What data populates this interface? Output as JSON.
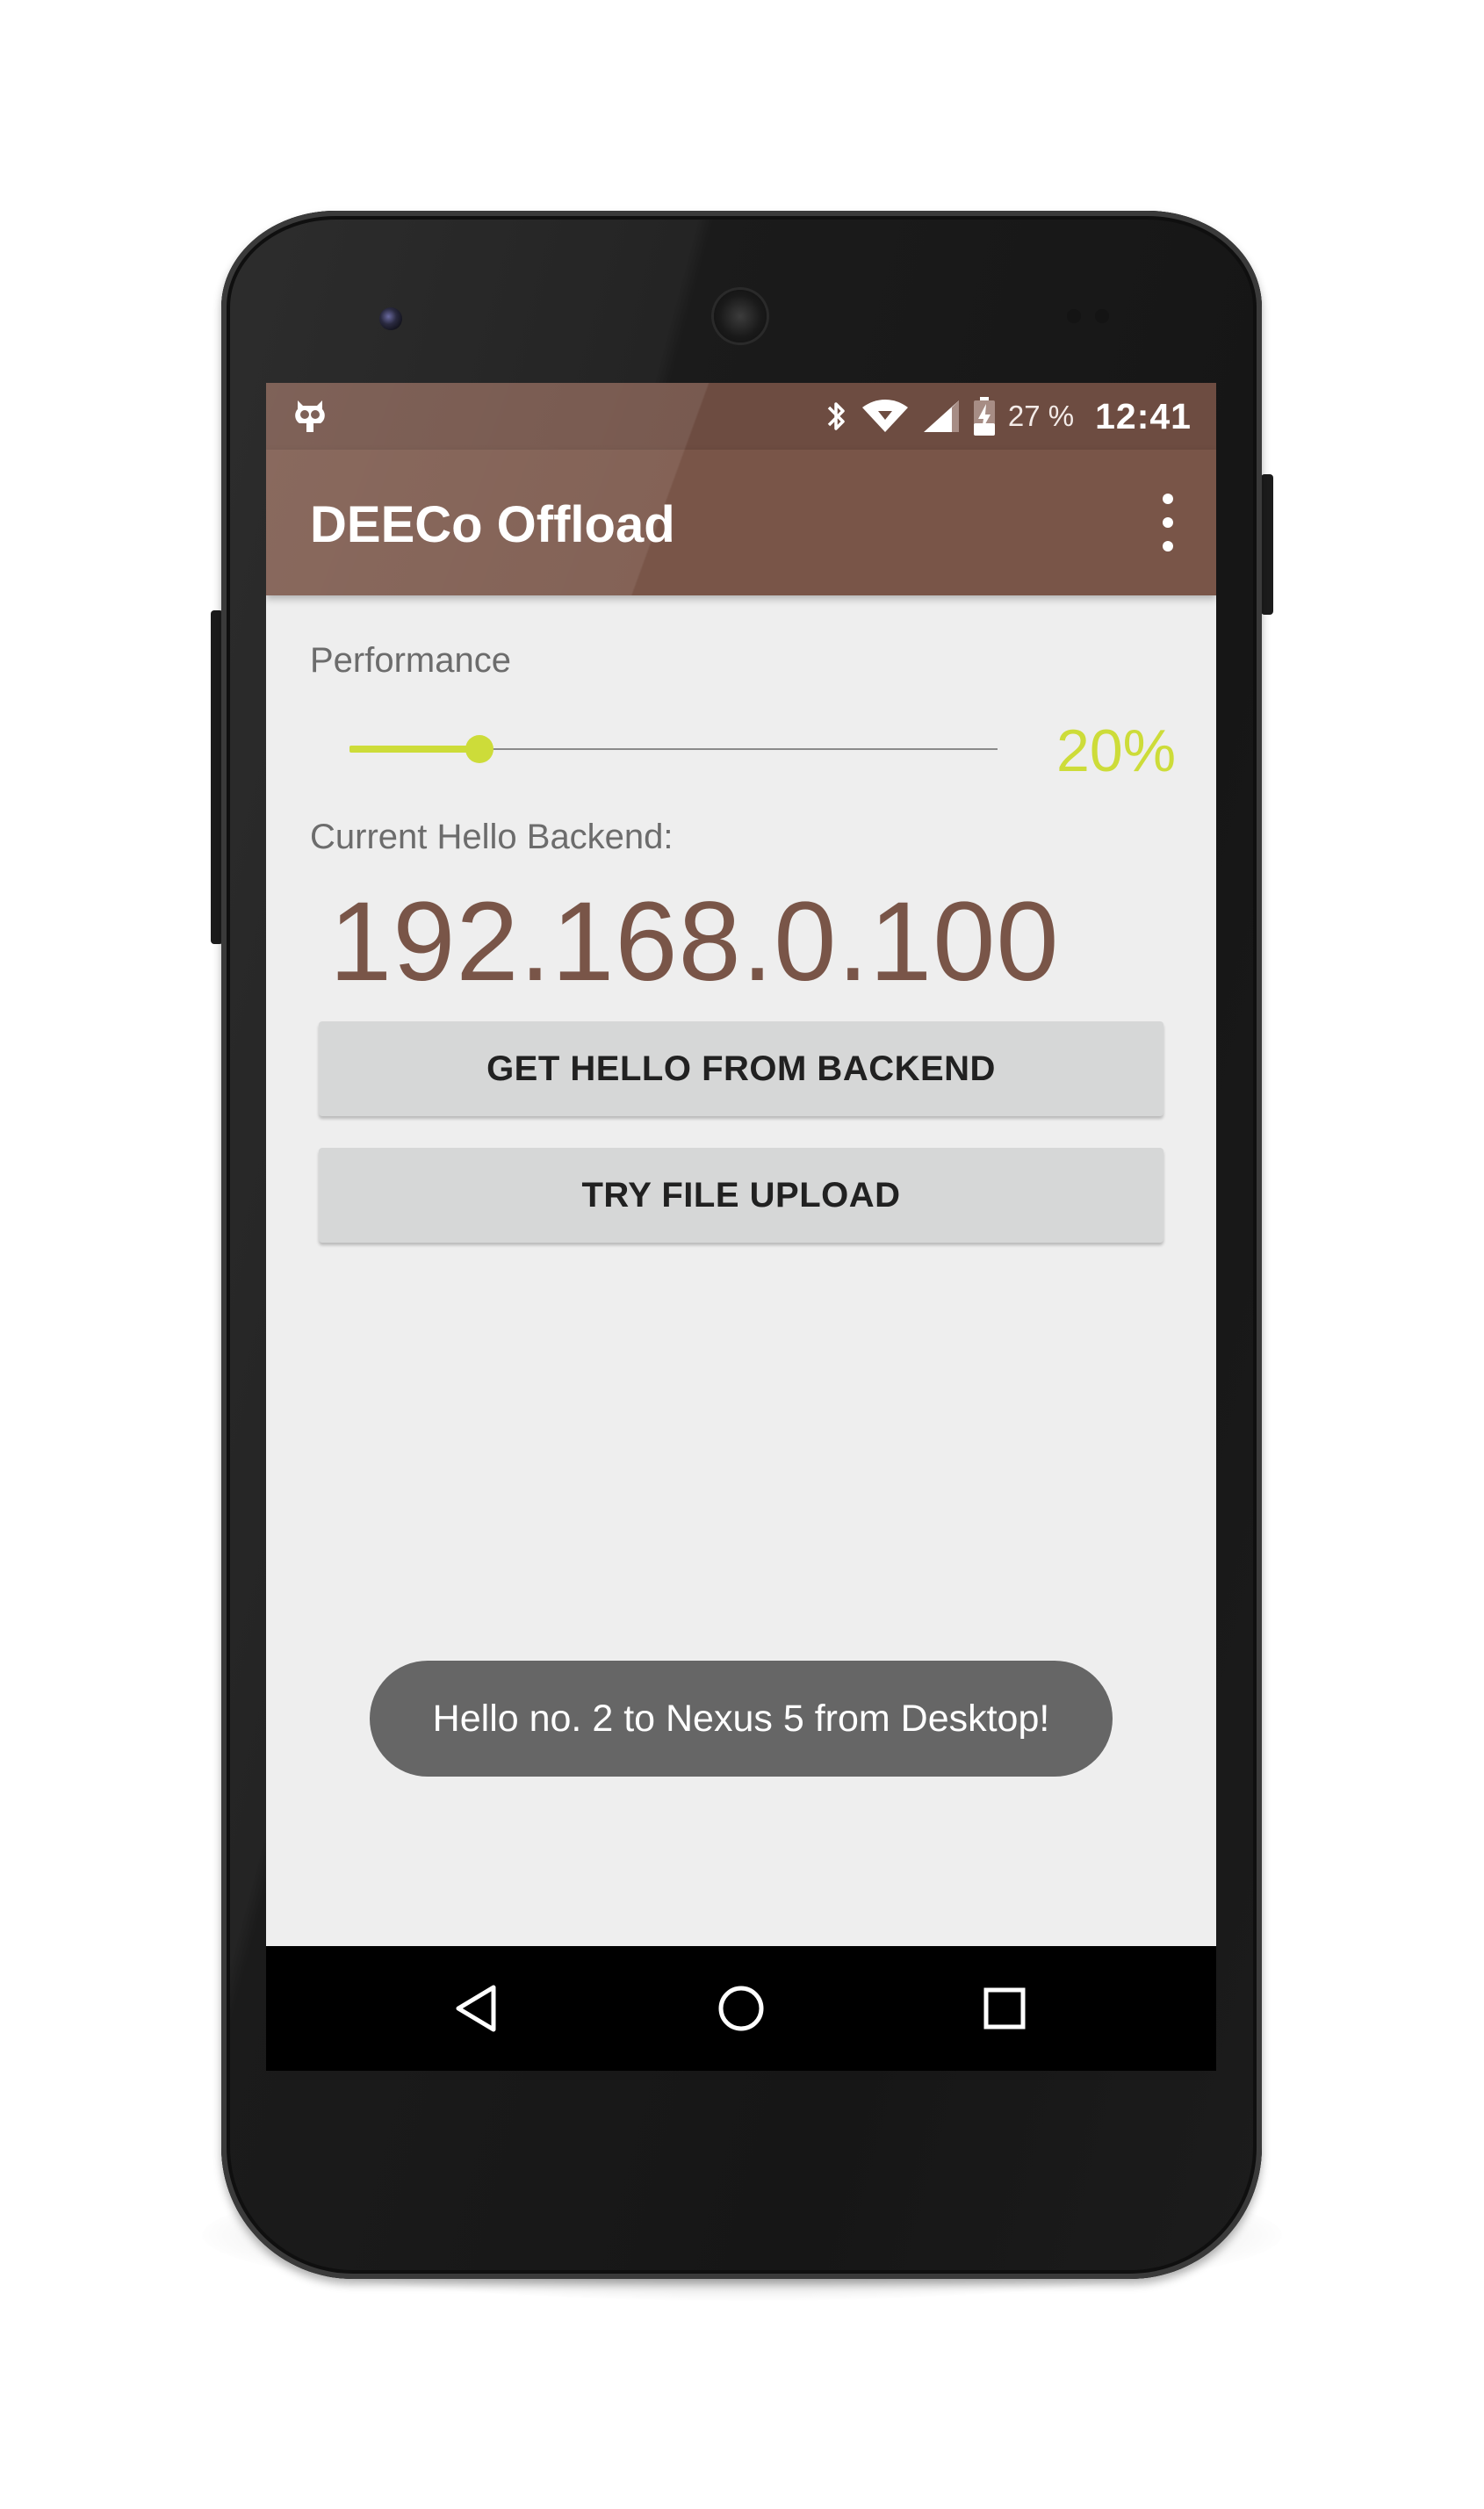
{
  "status_bar": {
    "left_icon": "cyanogenmod-icon",
    "icons": [
      "bluetooth-icon",
      "wifi-icon",
      "signal-icon",
      "battery-charging-icon"
    ],
    "battery_percent": "27 %",
    "time": "12:41"
  },
  "app_bar": {
    "title": "DEECo Offload",
    "menu_icon": "more-vert-icon"
  },
  "main": {
    "performance_label": "Performance",
    "performance_value": "20%",
    "performance_fraction": 0.2,
    "backend_label": "Current Hello Backend:",
    "backend_ip": "192.168.0.100",
    "buttons": {
      "get_hello": "GET HELLO FROM BACKEND",
      "file_upload": "TRY FILE UPLOAD"
    }
  },
  "toast": {
    "message": "Hello no. 2 to Nexus 5 from Desktop!"
  },
  "nav_bar": {
    "icons": [
      "back-icon",
      "home-icon",
      "recents-icon"
    ]
  },
  "colors": {
    "primary": "#795548",
    "primary_dark": "#6d4c41",
    "accent": "#cddc39",
    "background": "#eeeeee",
    "button": "#d6d7d7",
    "toast": "#666666"
  }
}
